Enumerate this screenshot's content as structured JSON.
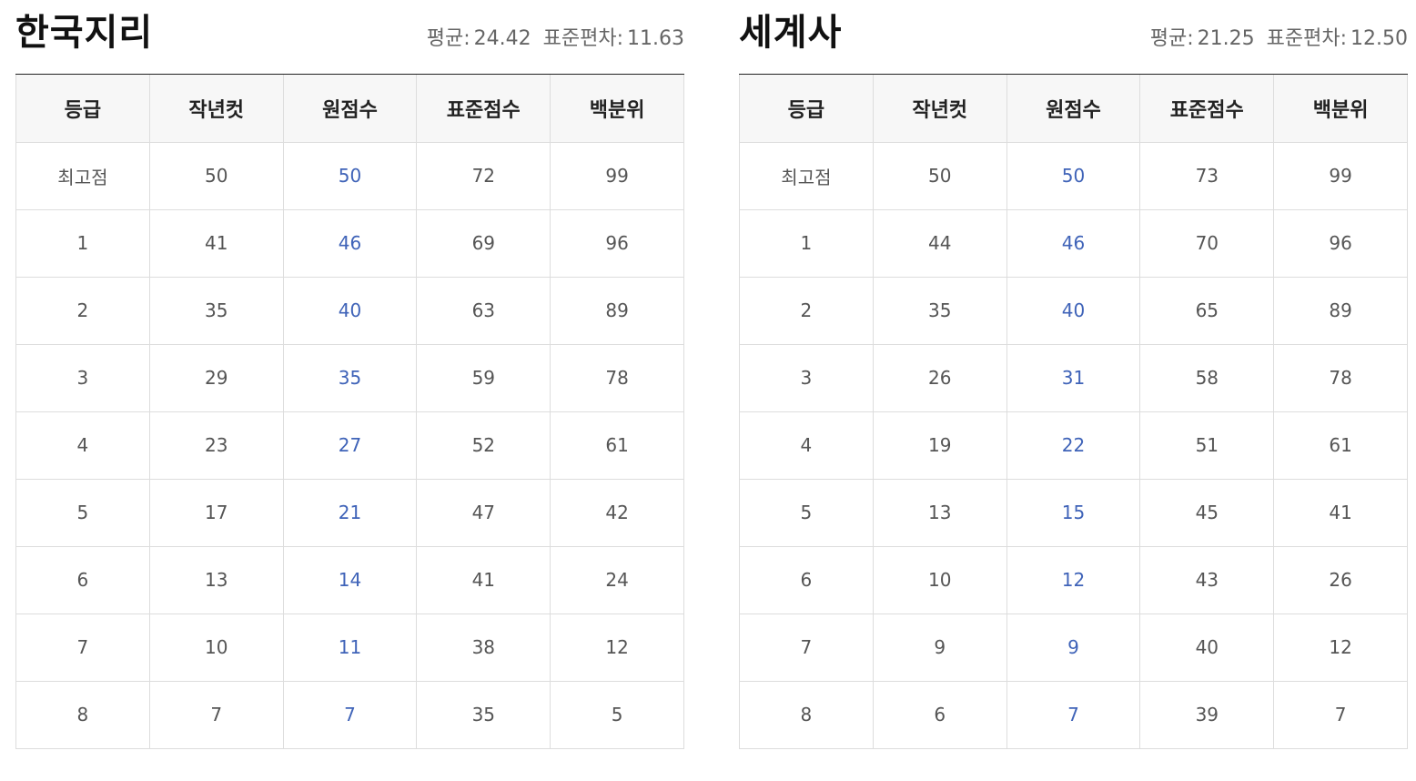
{
  "columns": [
    "등급",
    "작년컷",
    "원점수",
    "표준점수",
    "백분위"
  ],
  "stats_labels": {
    "mean": "평균:",
    "sd": "표준편차:"
  },
  "colors": {
    "raw_score": "#3f63b8",
    "header_bg": "#f7f7f7",
    "border": "#dddddd"
  },
  "panels": [
    {
      "title": "한국지리",
      "mean": "24.42",
      "sd": "11.63",
      "rows": [
        [
          "최고점",
          "50",
          "50",
          "72",
          "99"
        ],
        [
          "1",
          "41",
          "46",
          "69",
          "96"
        ],
        [
          "2",
          "35",
          "40",
          "63",
          "89"
        ],
        [
          "3",
          "29",
          "35",
          "59",
          "78"
        ],
        [
          "4",
          "23",
          "27",
          "52",
          "61"
        ],
        [
          "5",
          "17",
          "21",
          "47",
          "42"
        ],
        [
          "6",
          "13",
          "14",
          "41",
          "24"
        ],
        [
          "7",
          "10",
          "11",
          "38",
          "12"
        ],
        [
          "8",
          "7",
          "7",
          "35",
          "5"
        ]
      ]
    },
    {
      "title": "세계사",
      "mean": "21.25",
      "sd": "12.50",
      "rows": [
        [
          "최고점",
          "50",
          "50",
          "73",
          "99"
        ],
        [
          "1",
          "44",
          "46",
          "70",
          "96"
        ],
        [
          "2",
          "35",
          "40",
          "65",
          "89"
        ],
        [
          "3",
          "26",
          "31",
          "58",
          "78"
        ],
        [
          "4",
          "19",
          "22",
          "51",
          "61"
        ],
        [
          "5",
          "13",
          "15",
          "45",
          "41"
        ],
        [
          "6",
          "10",
          "12",
          "43",
          "26"
        ],
        [
          "7",
          "9",
          "9",
          "40",
          "12"
        ],
        [
          "8",
          "6",
          "7",
          "39",
          "7"
        ]
      ]
    }
  ]
}
